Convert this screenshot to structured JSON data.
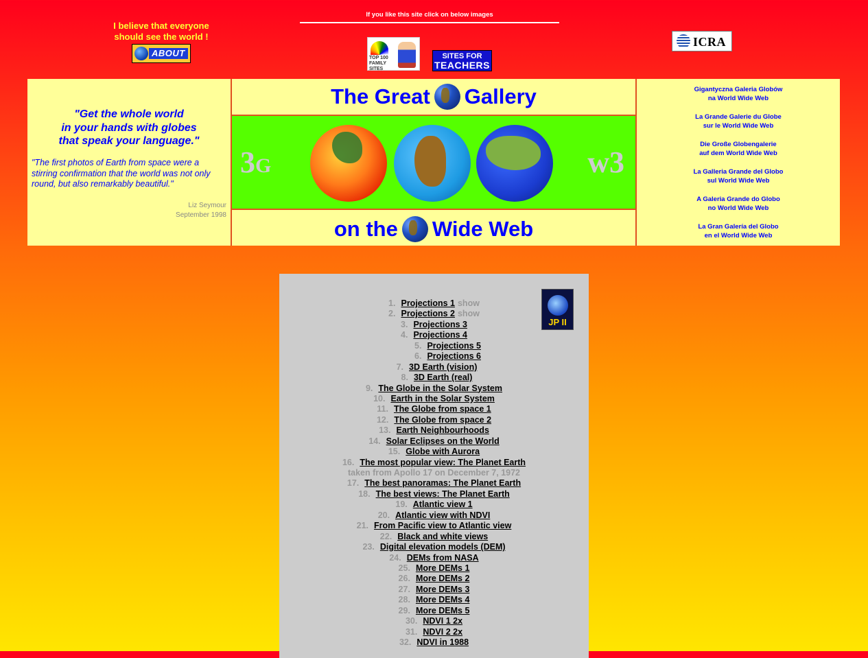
{
  "header": {
    "tagline": [
      "I believe that everyone",
      "should see the world !"
    ],
    "about_label": "ABOUT",
    "promo_text": "If you like this site click on below images",
    "top100_label": [
      "TOP 100",
      "FAMILY",
      "SITES"
    ],
    "teachers_label": [
      "SITES FOR",
      "TEACHERS"
    ],
    "icra_label": "ICRA"
  },
  "quote": {
    "main": [
      "\"Get the whole world",
      "in your hands with globes",
      "that speak your language.\""
    ],
    "text": "\"The first photos of Earth from space were a stirring confirmation that the world was not only round, but also remarkably beautiful.\"",
    "author": "Liz Seymour",
    "date": "September 1998"
  },
  "banner": {
    "title_left": "The Great",
    "title_right": "Gallery",
    "bottom_left": "on the",
    "bottom_right": "Wide Web",
    "tag_left_big": "3",
    "tag_left_small": "G",
    "tag_right": "w3"
  },
  "languages": [
    [
      "Gigantyczna Galeria Globów",
      "na World Wide Web"
    ],
    [
      "La Grande Galerie du Globe",
      "sur le World Wide Web"
    ],
    [
      "Die Große Globengalerie",
      "auf dem World Wide Web"
    ],
    [
      "La Galleria Grande del Globo",
      "sul World Wide Web"
    ],
    [
      "A Galeria Grande do Globo",
      "no World Wide Web"
    ],
    [
      "La Gran Galería del Globo",
      "en el World Wide Web"
    ]
  ],
  "badge": {
    "label": "JP II"
  },
  "items": [
    {
      "num": "1.",
      "label": "Projections 1",
      "extra": "show"
    },
    {
      "num": "2.",
      "label": "Projections 2",
      "extra": "show"
    },
    {
      "num": "3.",
      "label": "Projections 3"
    },
    {
      "num": "4.",
      "label": "Projections 4"
    },
    {
      "num": "5.",
      "label": "Projections 5"
    },
    {
      "num": "6.",
      "label": "Projections 6"
    },
    {
      "num": "7.",
      "label": "3D Earth (vision)"
    },
    {
      "num": "8.",
      "label": "3D Earth (real)"
    },
    {
      "num": "9.",
      "label": "The Globe in the Solar System"
    },
    {
      "num": "10.",
      "label": "Earth in the Solar System"
    },
    {
      "num": "11.",
      "label": "The Globe from space 1"
    },
    {
      "num": "12.",
      "label": "The Globe from space 2"
    },
    {
      "num": "13.",
      "label": "Earth Neighbourhoods"
    },
    {
      "num": "14.",
      "label": "Solar Eclipses on the World"
    },
    {
      "num": "15.",
      "label": "Globe with Aurora"
    },
    {
      "num": "16.",
      "label": "The most popular view: The Planet Earth",
      "sub": "taken from Apollo 17 on December 7, 1972"
    },
    {
      "num": "17.",
      "label": "The best panoramas: The Planet Earth"
    },
    {
      "num": "18.",
      "label": "The best views: The Planet Earth"
    },
    {
      "num": "19.",
      "label": "Atlantic view 1"
    },
    {
      "num": "20.",
      "label": "Atlantic view with NDVI"
    },
    {
      "num": "21.",
      "label": "From Pacific view to Atlantic view"
    },
    {
      "num": "22.",
      "label": "Black and white views"
    },
    {
      "num": "23.",
      "label": "Digital elevation models (DEM)"
    },
    {
      "num": "24.",
      "label": "DEMs from NASA"
    },
    {
      "num": "25.",
      "label": "More DEMs 1"
    },
    {
      "num": "26.",
      "label": "More DEMs 2"
    },
    {
      "num": "27.",
      "label": "More DEMs 3"
    },
    {
      "num": "28.",
      "label": "More DEMs 4"
    },
    {
      "num": "29.",
      "label": "More DEMs 5"
    },
    {
      "num": "30.",
      "label": "NDVI 1 2x"
    },
    {
      "num": "31.",
      "label": "NDVI 2 2x"
    },
    {
      "num": "32.",
      "label": "NDVI in 1988"
    }
  ]
}
